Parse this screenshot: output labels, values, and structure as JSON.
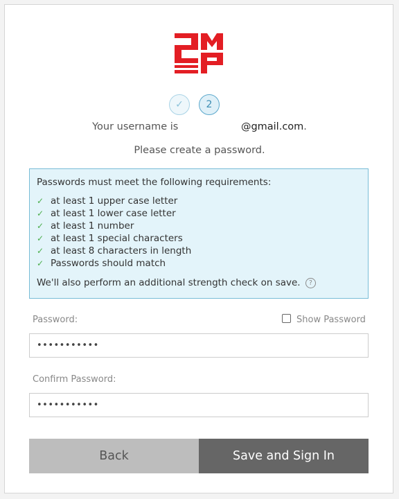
{
  "brand": {
    "logo_text": "2MP",
    "logo_color": "#e31e24"
  },
  "steps": {
    "completed_icon": "check-icon",
    "current_label": "2"
  },
  "account": {
    "username_prefix": "Your username is",
    "username_domain": "@gmail.com",
    "username_suffix": "."
  },
  "subtitle": "Please create a password.",
  "requirements": {
    "title": "Passwords must meet the following requirements:",
    "items": [
      "at least 1 upper case letter",
      "at least 1 lower case letter",
      "at least 1 number",
      "at least 1 special characters",
      "at least 8 characters in length",
      "Passwords should match"
    ],
    "note": "We'll also perform an additional strength check on save.",
    "help_icon": "?",
    "check_color": "#4cae4c",
    "box_background": "#e3f4fa",
    "box_border": "#78bcd6"
  },
  "form": {
    "password_label": "Password:",
    "password_value": "•••••••••••",
    "show_password_label": "Show Password",
    "show_password_checked": false,
    "confirm_label": "Confirm Password:",
    "confirm_value": "•••••••••••"
  },
  "actions": {
    "back_label": "Back",
    "save_label": "Save and Sign In"
  }
}
